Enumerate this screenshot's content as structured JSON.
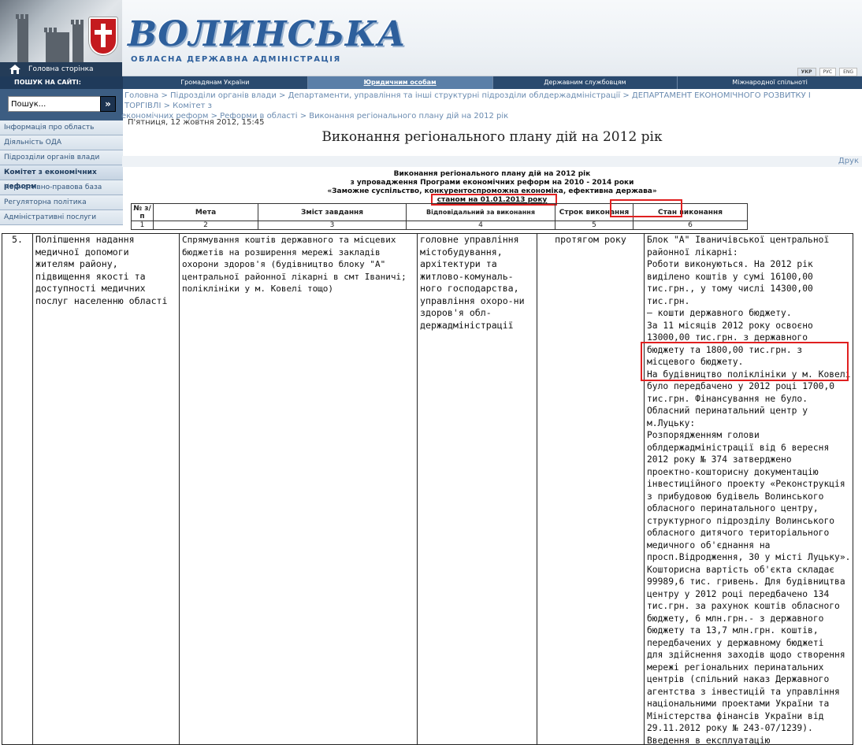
{
  "header": {
    "logo_title": "ВОЛИНСЬКА",
    "logo_subtitle": "ОБЛАСНА ДЕРЖАВНА АДМІНІСТРАЦІЯ",
    "home_link": "Головна сторінка",
    "languages": [
      "УКР",
      "РУС",
      "ENG"
    ]
  },
  "topnav": [
    "Громадянам України",
    "Юридичним особам",
    "Державним службовцям",
    "Міжнародної спільноті"
  ],
  "breadcrumb": {
    "line1": "Головна > Підрозділи органів влади > Департаменти, управління та інші структурні підрозділи облдержадміністрації > ДЕПАРТАМЕНТ ЕКОНОМІЧНОГО РОЗВИТКУ І ТОРГІВЛІ > Комітет з",
    "line2": "економічних реформ > Реформи в області > Виконання регіонального плану дій на 2012 рік"
  },
  "sidebar": {
    "search_title": "ПОШУК НА САЙТІ:",
    "search_value": "Пошук...",
    "search_button": "»",
    "items": [
      "Інформація про область",
      "Діяльність ОДА",
      "Підрозділи органів влади",
      "Комітет з економічних реформ",
      "Нормативно-правова база",
      "Регуляторна політика",
      "Адміністративні послуги"
    ]
  },
  "content": {
    "date": "П'ятниця, 12 жовтня 2012, 15:45",
    "title": "Виконання регіонального плану дій на 2012 рік",
    "print": "Друк"
  },
  "document": {
    "head_line1": "Виконання регіонального плану дій на 2012 рік",
    "head_line2": "з упровадження Програми економічних реформ на 2010 - 2014 роки",
    "head_line3": "«Заможне суспільство, конкурентоспроможна економіка, ефективна держава»",
    "as_of": "станом на 01.01.2013 року",
    "columns": [
      "№ з/п",
      "Мета",
      "Зміст завдання",
      "Відповідальний за виконання",
      "Строк виконання",
      "Стан виконання"
    ],
    "column_numbers": [
      "1",
      "2",
      "3",
      "4",
      "5",
      "6"
    ],
    "row": {
      "num": "5.",
      "goal": "Поліпшення надання\nмедичної допомоги\nжителям району,\nпідвищення якості та\nдоступності медичних\nпослуг населенню області",
      "task": "Спрямування коштів державного та місцевих\nбюджетів на розширення мережі закладів\nохорони здоров'я (будівництво блоку \"А\"\nцентральної районної лікарні в смт Іваничі;\nполіклініки у м. Ковелі тощо)",
      "responsible": "головне управління\nмістобудування,\nархітектури та\nжитлово-комуналь-\nного господарства,\nуправління охоро-ни\nздоров'я обл-\nдержадміністрації",
      "term": "протягом року",
      "status": "Блок \"А\" Іваничівської центральної\nрайонної лікарні:\nРоботи виконуються. На 2012 рік\nвиділено коштів у сумі 16100,00\nтис.грн., у тому числі 14300,00 тис.грн.\n– кошти державного бюджету.\nЗа 11 місяців 2012 року освоєно\n13000,00 тис.грн. з державного\nбюджету та 1800,00 тис.грн. з\nмісцевого бюджету.\nНа будівництво поліклініки у м. Ковелі\nбуло передбачено у 2012 році 1700,0\nтис.грн. Фінансування не було.\nОбласний перинатальний центр у\nм.Луцьку:\nРозпорядженням голови\nоблдержадміністрації від 6 вересня\n2012 року № 374 затверджено\nпроектно-кошторисну документацію\nінвестиційного проекту «Реконструкція\nз прибудовою будівель Волинського\nобласного перинатального центру,\nструктурного підрозділу Волинського\nобласного дитячого територіального\nмедичного об'єднання на\nпросп.Відродження, 30 у місті Луцьку».\nКошторисна вартість об'єкта складає\n99989,6 тис. гривень. Для будівництва\nцентру у 2012 році передбачено 134\nтис.грн. за рахунок коштів обласного\nбюджету, 6 млн.грн.- з державного\nбюджету та 13,7 млн.грн. коштів,\nпередбачених у державному бюджеті\nдля здійснення заходів щодо створення\nмережі регіональних перинатальних\nцентрів (спільний наказ Державного\nагентства з інвестицій та управління\nнаціональними проектами України та\nМіністерства фінансів України від\n29.11.2012 року № 243-07/1239).\nВведення в експлуатацію\nперинатального центру із пологовим\nбудинком забезпечить створення умов\nдля підвищення якості медичних\nпослуг, надання їх відповідно до\nєвропейського рівня."
    }
  },
  "colors": {
    "nav_dark": "#2a4a6e",
    "nav_active": "#5a7fa8",
    "link": "#6a8bb0",
    "highlight_box": "#e02020"
  }
}
